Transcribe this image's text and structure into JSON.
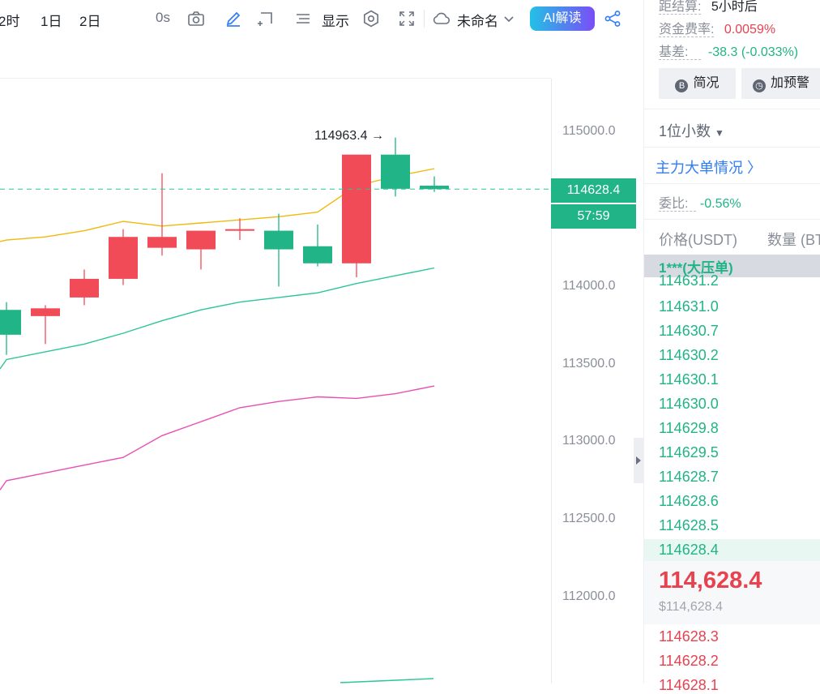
{
  "toolbar": {
    "intervals": [
      "2时",
      "1日",
      "2日"
    ],
    "timer": "0s",
    "display_label": "显示",
    "layout_name": "未命名",
    "ai_button": "AI解读"
  },
  "y_axis": {
    "ticks": [
      "115000.0",
      "114000.0",
      "113500.0",
      "113000.0",
      "112500.0",
      "112000.0"
    ]
  },
  "chart": {
    "high_annotation": "114963.4",
    "last_price_tag": "114628.4",
    "countdown": "57:59",
    "colors": {
      "up": "#f04b57",
      "down": "#20b486",
      "ma_yellow": "#f0b90b",
      "ma_teal": "#2dc59a",
      "ma_pink": "#e84fb4"
    }
  },
  "chart_data": {
    "type": "candlestick",
    "candles": [
      {
        "open": 113850,
        "high": 113900,
        "low": 113560,
        "close": 113690
      },
      {
        "open": 113810,
        "high": 113880,
        "low": 113630,
        "close": 113860
      },
      {
        "open": 113930,
        "high": 114110,
        "low": 113880,
        "close": 114050
      },
      {
        "open": 114050,
        "high": 114370,
        "low": 114010,
        "close": 114320
      },
      {
        "open": 114250,
        "high": 114730,
        "low": 114200,
        "close": 114320
      },
      {
        "open": 114240,
        "high": 114360,
        "low": 114110,
        "close": 114360
      },
      {
        "open": 114360,
        "high": 114440,
        "low": 114300,
        "close": 114370
      },
      {
        "open": 114360,
        "high": 114470,
        "low": 114000,
        "close": 114240
      },
      {
        "open": 114260,
        "high": 114400,
        "low": 114130,
        "close": 114150
      },
      {
        "open": 114150,
        "high": 114850,
        "low": 114060,
        "close": 114850
      },
      {
        "open": 114850,
        "high": 114960,
        "low": 114580,
        "close": 114630
      },
      {
        "open": 114650,
        "high": 114710,
        "low": 114610,
        "close": 114628
      }
    ],
    "moving_averages": [
      {
        "color": "#f0b90b",
        "values": [
          114300,
          114320,
          114360,
          114420,
          114390,
          114410,
          114430,
          114450,
          114480,
          114650,
          114710,
          114760
        ]
      },
      {
        "color": "#2dc59a",
        "values": [
          113530,
          113580,
          113630,
          113700,
          113780,
          113850,
          113900,
          113930,
          113960,
          114020,
          114070,
          114120
        ]
      },
      {
        "color": "#e84fb4",
        "values": [
          112750,
          112800,
          112850,
          112900,
          113040,
          113130,
          113220,
          113260,
          113290,
          113280,
          113310,
          113360
        ]
      }
    ],
    "ylim": [
      111500,
      115400
    ]
  },
  "right_panel": {
    "settlement_label": "距结算:",
    "settlement_value": "5小时后",
    "funding_label": "资金费率:",
    "funding_value": "0.0059%",
    "basis_label": "基差:",
    "basis_value": "-38.3 (-0.033%)",
    "brief_button": "简况",
    "alert_button": "加预警",
    "decimal_select": "1位小数",
    "big_orders_link": "主力大单情况",
    "commission_label": "委比:",
    "commission_value": "-0.56%",
    "col_price": "价格(USDT)",
    "col_qty": "数量 (BT",
    "big_order_label": "1***(大压单)",
    "asks": [
      "114631.2",
      "114631.0",
      "114630.7",
      "114630.2",
      "114630.1",
      "114630.0",
      "114629.8",
      "114629.5",
      "114628.7",
      "114628.6",
      "114628.5",
      "114628.4"
    ],
    "last_price": "114,628.4",
    "last_price_usd": "$114,628.4",
    "bids": [
      "114628.3",
      "114628.2",
      "114628.1"
    ]
  }
}
